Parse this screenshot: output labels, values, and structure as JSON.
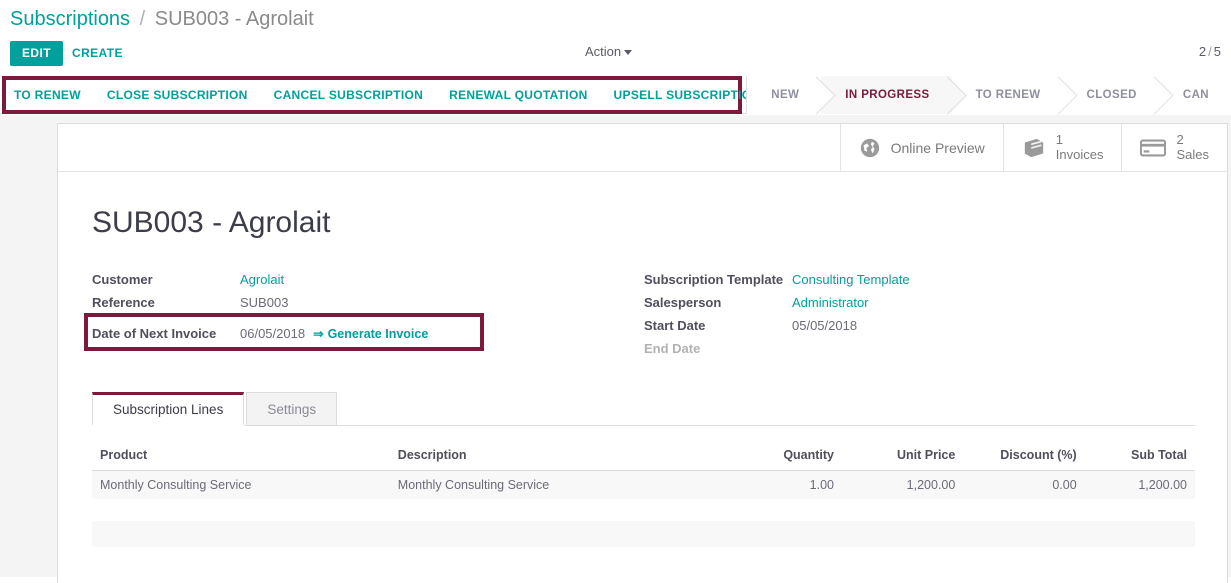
{
  "breadcrumb": {
    "root": "Subscriptions",
    "separator": "/",
    "current": "SUB003 - Agrolait"
  },
  "control_panel": {
    "edit_label": "EDIT",
    "create_label": "CREATE",
    "action_label": "Action",
    "pager": {
      "current": "2",
      "separator": "/",
      "total": "5"
    }
  },
  "action_buttons": [
    {
      "label": "TO RENEW",
      "name": "to-renew-button"
    },
    {
      "label": "CLOSE SUBSCRIPTION",
      "name": "close-subscription-button"
    },
    {
      "label": "CANCEL SUBSCRIPTION",
      "name": "cancel-subscription-button"
    },
    {
      "label": "RENEWAL QUOTATION",
      "name": "renewal-quotation-button"
    },
    {
      "label": "UPSELL SUBSCRIPTION",
      "name": "upsell-subscription-button"
    }
  ],
  "statusbar": {
    "stages": [
      {
        "label": "NEW",
        "active": false
      },
      {
        "label": "IN PROGRESS",
        "active": true
      },
      {
        "label": "TO RENEW",
        "active": false
      },
      {
        "label": "CLOSED",
        "active": false
      },
      {
        "label": "CAN",
        "active": false
      }
    ]
  },
  "smart_buttons": [
    {
      "icon": "globe-icon",
      "value": "",
      "label": "Online Preview"
    },
    {
      "icon": "book-icon",
      "value": "1",
      "label": "Invoices"
    },
    {
      "icon": "credit-card-icon",
      "value": "2",
      "label": "Sales"
    }
  ],
  "record": {
    "title": "SUB003 - Agrolait",
    "left_fields": [
      {
        "label": "Customer",
        "value": "Agrolait",
        "is_link": true
      },
      {
        "label": "Reference",
        "value": "SUB003",
        "is_link": false
      }
    ],
    "next_invoice": {
      "label": "Date of Next Invoice",
      "value": "06/05/2018",
      "action_arrow": "⇒",
      "action_label": "Generate Invoice"
    },
    "right_fields": [
      {
        "label": "Subscription Template",
        "value": "Consulting Template",
        "is_link": true
      },
      {
        "label": "Salesperson",
        "value": "Administrator",
        "is_link": true
      },
      {
        "label": "Start Date",
        "value": "05/05/2018",
        "is_link": false
      },
      {
        "label": "End Date",
        "value": "",
        "is_link": false,
        "muted": true
      }
    ]
  },
  "notebook": {
    "tabs": [
      {
        "label": "Subscription Lines",
        "active": true
      },
      {
        "label": "Settings",
        "active": false
      }
    ]
  },
  "lines_table": {
    "columns": [
      "Product",
      "Description",
      "Quantity",
      "Unit Price",
      "Discount (%)",
      "Sub Total"
    ],
    "rows": [
      {
        "product": "Monthly Consulting Service",
        "description": "Monthly Consulting Service",
        "quantity": "1.00",
        "unit_price": "1,200.00",
        "discount": "0.00",
        "sub_total": "1,200.00"
      }
    ]
  },
  "colors": {
    "accent_teal": "#00a09d",
    "highlight_maroon": "#7b1a3c",
    "stage_active": "#7b1a3c"
  }
}
